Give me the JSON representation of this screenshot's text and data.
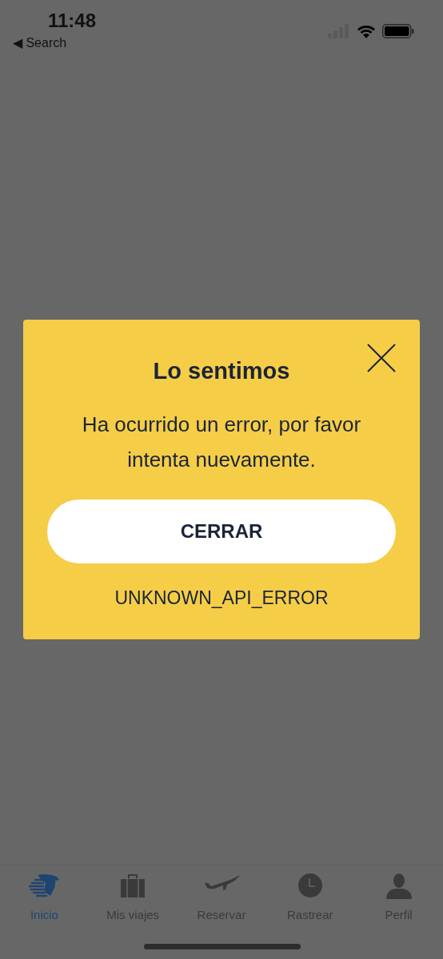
{
  "status_bar": {
    "time": "11:48",
    "back_label": "◀ Search"
  },
  "dialog": {
    "title": "Lo sentimos",
    "message": "Ha ocurrido un error, por favor intenta nuevamente.",
    "button": "CERRAR",
    "error_code": "UNKNOWN_API_ERROR"
  },
  "tab_bar": [
    {
      "label": "Inicio",
      "kind": "home",
      "selected": true
    },
    {
      "label": "Mis viajes",
      "kind": "trips",
      "selected": false
    },
    {
      "label": "Reservar",
      "kind": "book",
      "selected": false
    },
    {
      "label": "Rastrear",
      "kind": "track",
      "selected": false
    },
    {
      "label": "Perfil",
      "kind": "profile",
      "selected": false
    }
  ]
}
